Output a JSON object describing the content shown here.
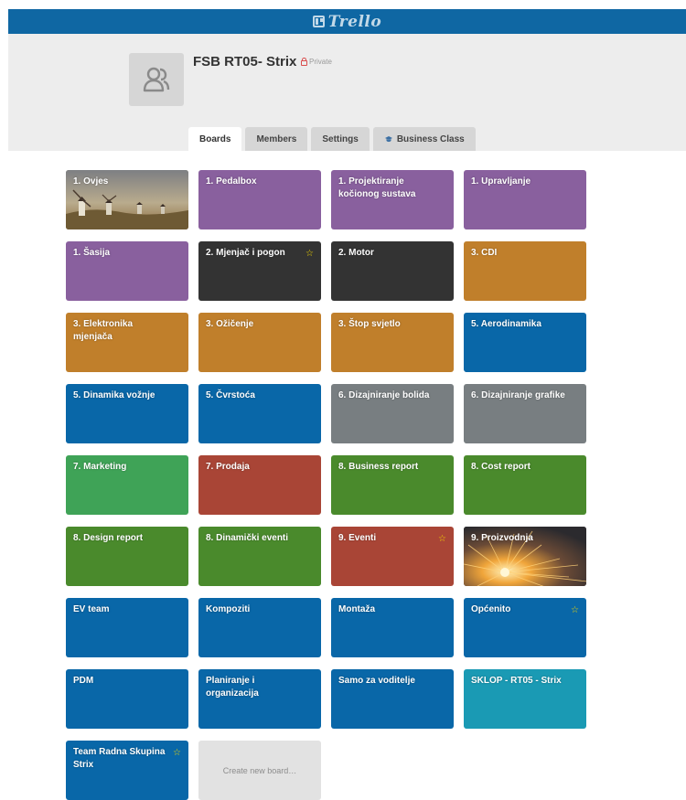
{
  "app": {
    "logo_text": "Trello"
  },
  "team": {
    "name": "FSB RT05- Strix",
    "visibility": "Private"
  },
  "tabs": [
    {
      "label": "Boards",
      "active": true
    },
    {
      "label": "Members",
      "active": false
    },
    {
      "label": "Settings",
      "active": false
    },
    {
      "label": "Business Class",
      "active": false,
      "icon": "business-class-icon"
    }
  ],
  "boards": [
    {
      "name": "1. Ovjes",
      "color": "photo-windmills",
      "starred": false
    },
    {
      "name": "1. Pedalbox",
      "color": "#89609e",
      "starred": false
    },
    {
      "name": "1. Projektiranje kočionog sustava",
      "color": "#89609e",
      "starred": false
    },
    {
      "name": "1. Upravljanje",
      "color": "#89609e",
      "starred": false
    },
    {
      "name": "1. Šasija",
      "color": "#89609e",
      "starred": false
    },
    {
      "name": "2. Mjenjač i pogon",
      "color": "#333333",
      "starred": true
    },
    {
      "name": "2. Motor",
      "color": "#333333",
      "starred": false
    },
    {
      "name": "3. CDI",
      "color": "#c07f2b",
      "starred": false
    },
    {
      "name": "3. Elektronika mjenjača",
      "color": "#c07f2b",
      "starred": false
    },
    {
      "name": "3. Ožičenje",
      "color": "#c07f2b",
      "starred": false
    },
    {
      "name": "3. Štop svjetlo",
      "color": "#c07f2b",
      "starred": false
    },
    {
      "name": "5. Aerodinamika",
      "color": "#0967a8",
      "starred": false
    },
    {
      "name": "5. Dinamika vožnje",
      "color": "#0967a8",
      "starred": false
    },
    {
      "name": "5. Čvrstoća",
      "color": "#0967a8",
      "starred": false
    },
    {
      "name": "6. Dizajniranje bolida",
      "color": "#787e81",
      "starred": false
    },
    {
      "name": "6. Dizajniranje grafike",
      "color": "#787e81",
      "starred": false
    },
    {
      "name": "7. Marketing",
      "color": "#3fa357",
      "starred": false
    },
    {
      "name": "7. Prodaja",
      "color": "#a94536",
      "starred": false
    },
    {
      "name": "8. Business report",
      "color": "#4a8a2c",
      "starred": false
    },
    {
      "name": "8. Cost report",
      "color": "#4a8a2c",
      "starred": false
    },
    {
      "name": "8. Design report",
      "color": "#4a8a2c",
      "starred": false
    },
    {
      "name": "8. Dinamički eventi",
      "color": "#4a8a2c",
      "starred": false
    },
    {
      "name": "9. Eventi",
      "color": "#a94536",
      "starred": true
    },
    {
      "name": "9. Proizvodnja",
      "color": "photo-sparks",
      "starred": false
    },
    {
      "name": "EV team",
      "color": "#0967a8",
      "starred": false
    },
    {
      "name": "Kompoziti",
      "color": "#0967a8",
      "starred": false
    },
    {
      "name": "Montaža",
      "color": "#0967a8",
      "starred": false
    },
    {
      "name": "Općenito",
      "color": "#0967a8",
      "starred": true
    },
    {
      "name": "PDM",
      "color": "#0967a8",
      "starred": false
    },
    {
      "name": "Planiranje i organizacija",
      "color": "#0967a8",
      "starred": false
    },
    {
      "name": "Samo za voditelje",
      "color": "#0967a8",
      "starred": false
    },
    {
      "name": "SKLOP - RT05 - Strix",
      "color": "#1a9ab4",
      "starred": false
    },
    {
      "name": "Team Radna Skupina Strix",
      "color": "#0967a8",
      "starred": true
    }
  ],
  "create_board_label": "Create new board…"
}
